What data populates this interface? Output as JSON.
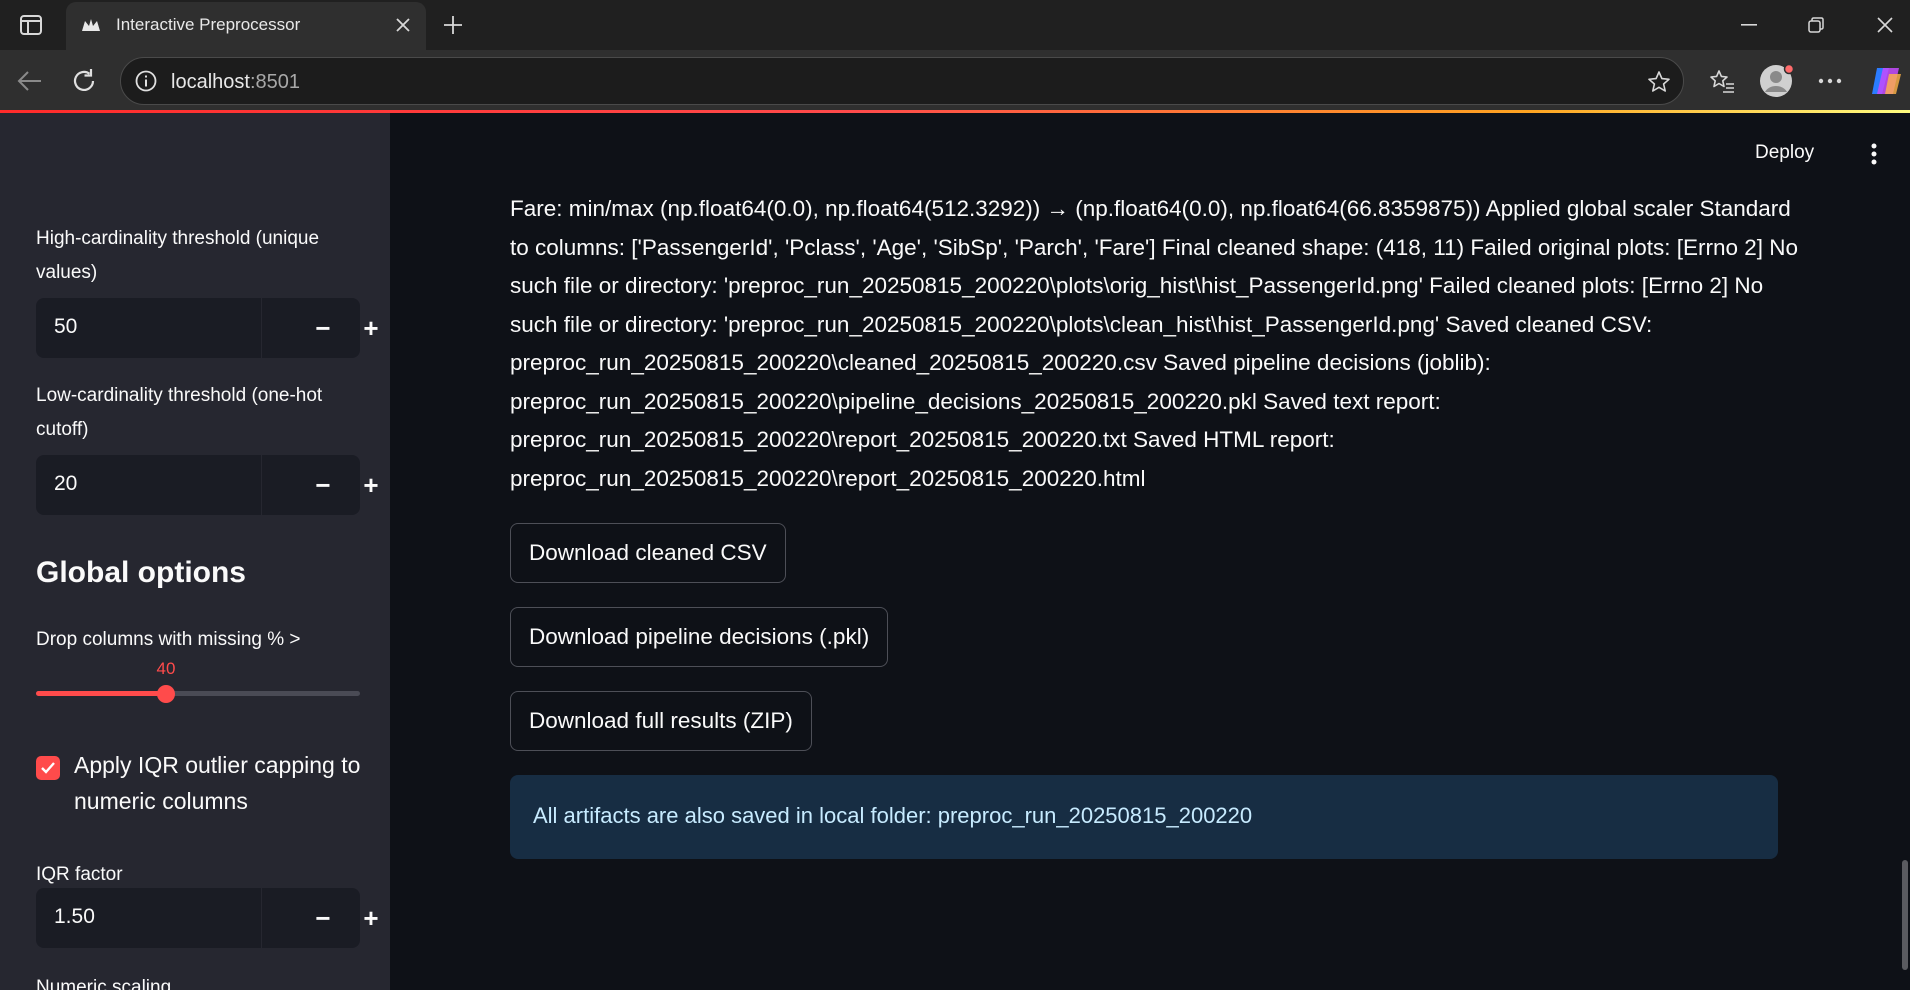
{
  "browser": {
    "tab_title": "Interactive Preprocessor",
    "url_host": "localhost",
    "url_port": ":8501",
    "icons": [
      "tab-actions-icon",
      "app-favicon",
      "close-icon",
      "plus-icon",
      "minimize-icon",
      "restore-icon",
      "window-close-icon",
      "back-icon",
      "reload-icon",
      "info-icon",
      "star-icon",
      "favorites-icon",
      "profile-icon",
      "more-icon",
      "copilot-icon"
    ]
  },
  "sidebar": {
    "high_card": {
      "label": "High-cardinality threshold (unique values)",
      "value": "50"
    },
    "low_card": {
      "label": "Low-cardinality threshold (one-hot cutoff)",
      "value": "20"
    },
    "global_heading": "Global options",
    "drop_missing": {
      "label": "Drop columns with missing % >",
      "value": "40",
      "fraction": 0.4
    },
    "iqr_capping": {
      "label": "Apply IQR outlier capping to numeric columns",
      "checked": true
    },
    "iqr_factor": {
      "label": "IQR factor",
      "value": "1.50"
    },
    "numeric_scaling": {
      "label": "Numeric scaling"
    },
    "minus": "−",
    "plus": "+"
  },
  "main": {
    "deploy": "Deploy",
    "log": "Fare: min/max (np.float64(0.0), np.float64(512.3292)) → (np.float64(0.0), np.float64(66.8359875)) Applied global scaler Standard to columns: ['PassengerId', 'Pclass', 'Age', 'SibSp', 'Parch', 'Fare'] Final cleaned shape: (418, 11) Failed original plots: [Errno 2] No such file or directory: 'preproc_run_20250815_200220\\plots\\orig_hist\\hist_PassengerId.png' Failed cleaned plots: [Errno 2] No such file or directory: 'preproc_run_20250815_200220\\plots\\clean_hist\\hist_PassengerId.png' Saved cleaned CSV: preproc_run_20250815_200220\\cleaned_20250815_200220.csv Saved pipeline decisions (joblib): preproc_run_20250815_200220\\pipeline_decisions_20250815_200220.pkl Saved text report: preproc_run_20250815_200220\\report_20250815_200220.txt Saved HTML report: preproc_run_20250815_200220\\report_20250815_200220.html",
    "buttons": {
      "csv": "Download cleaned CSV",
      "pkl": "Download pipeline decisions (.pkl)",
      "zip": "Download full results (ZIP)"
    },
    "info": "All artifacts are also saved in local folder: preproc_run_20250815_200220"
  },
  "colors": {
    "accent": "#ff4b4b",
    "sidebar_bg": "#262730",
    "main_bg": "#0e1117",
    "info_bg": "#172d43",
    "info_text": "#c7ebff"
  }
}
